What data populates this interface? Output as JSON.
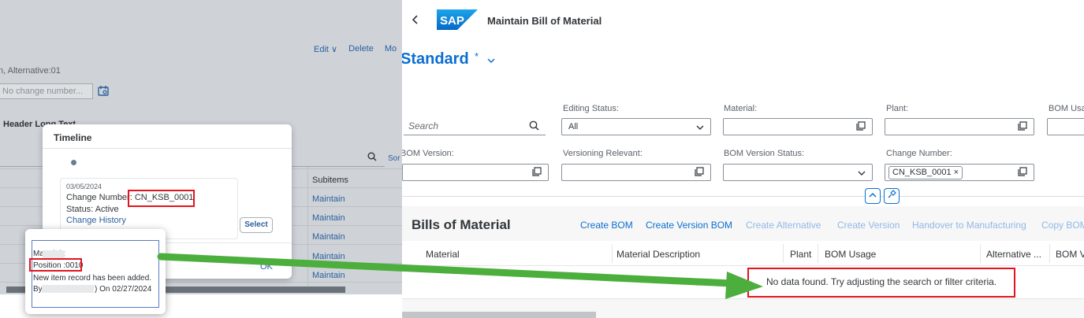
{
  "left_panel": {
    "header_actions": [
      "Edit ∨",
      "Delete",
      "Mo"
    ],
    "alt_text": "n, Alternative:01",
    "change_number_placeholder": "No change number...",
    "header_long_text": "Header Long Text",
    "sort_label": "Sor",
    "subitems_header": "Subitems",
    "maintain_links": [
      "Maintain",
      "Maintain",
      "Maintain",
      "Maintain",
      "Maintain"
    ],
    "ok_label": "OK",
    "timeline": {
      "title": "Timeline",
      "date": "03/05/2024",
      "change_number": "Change Number: CN_KSB_0001",
      "status": "Status: Active",
      "change_history": "Change History",
      "select_button": "Select"
    },
    "tooltip": {
      "material": "Material :",
      "position": "Position :0010",
      "message": "New item record has been added.",
      "by_prefix": "By",
      "on_date": ") On  02/27/2024"
    }
  },
  "app": {
    "title": "Maintain Bill of Material",
    "back_icon": "chevron-left-icon",
    "variant": {
      "name": "Standard",
      "modified": "*"
    }
  },
  "filters": {
    "search_placeholder": "Search",
    "row1": [
      {
        "label": "Editing Status:",
        "value": "All",
        "icon": "dropdown-icon"
      },
      {
        "label": "Material:",
        "value": "",
        "icon": "value-help-icon"
      },
      {
        "label": "Plant:",
        "value": "",
        "icon": "value-help-icon"
      },
      {
        "label": "BOM Usa",
        "value": "",
        "icon": "value-help-icon"
      }
    ],
    "row2": [
      {
        "label": "BOM Version:",
        "value": "",
        "icon": "value-help-icon"
      },
      {
        "label": "Versioning Relevant:",
        "value": "",
        "icon": "value-help-icon"
      },
      {
        "label": "BOM Version Status:",
        "value": "",
        "icon": "dropdown-icon"
      },
      {
        "label": "Change Number:",
        "token": "CN_KSB_0001 ×",
        "icon": "value-help-icon"
      }
    ]
  },
  "table": {
    "title": "Bills of Material",
    "toolbar": [
      {
        "label": "Create BOM",
        "enabled": true
      },
      {
        "label": "Create Version BOM",
        "enabled": true
      },
      {
        "label": "Create Alternative",
        "enabled": false
      },
      {
        "label": "Create Version",
        "enabled": false
      },
      {
        "label": "Handover to Manufacturing",
        "enabled": false
      },
      {
        "label": "Copy BOM",
        "enabled": false
      }
    ],
    "columns": [
      "Material",
      "Material Description",
      "Plant",
      "BOM Usage",
      "Alternative ...",
      "BOM V"
    ],
    "no_data": "No data found. Try adjusting the search or filter criteria."
  },
  "colors": {
    "accent": "#0a6ed1",
    "highlight_box": "#e3141e",
    "arrow": "#4cae3c"
  }
}
